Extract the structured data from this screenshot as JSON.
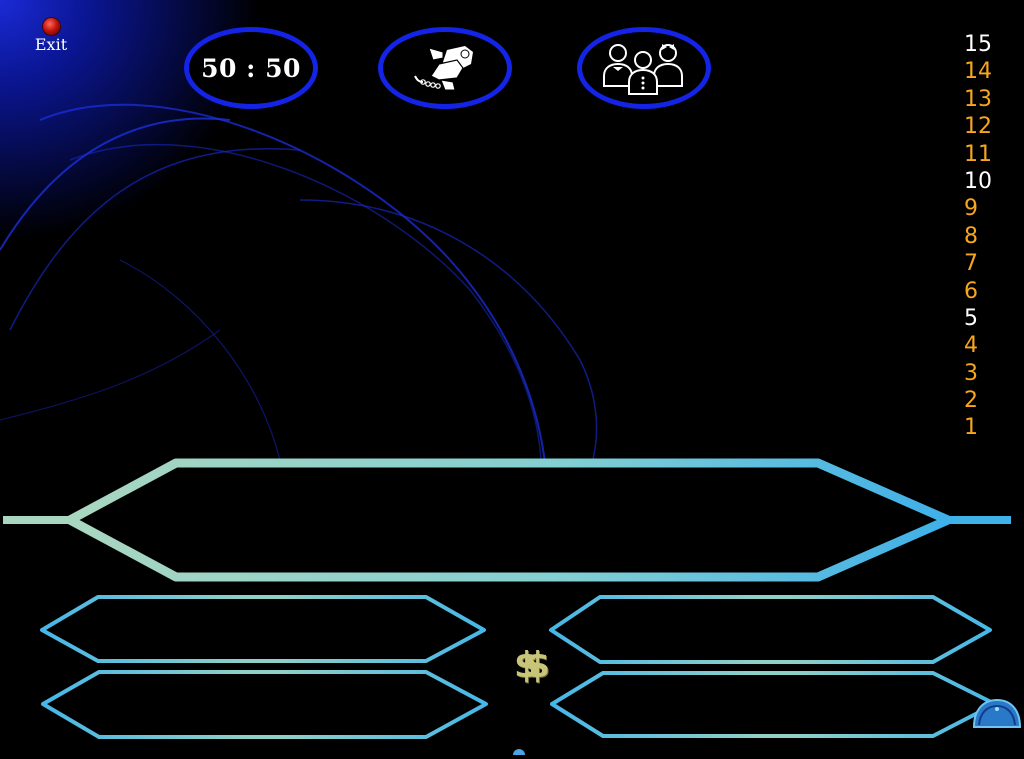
{
  "exit": {
    "label": "Exit"
  },
  "lifelines": {
    "fifty_fifty": {
      "label": "50 : 50",
      "icon": "fifty-fifty"
    },
    "phone_a_friend": {
      "icon": "phone-hand-icon"
    },
    "ask_audience": {
      "icon": "audience-people-icon"
    }
  },
  "ladder": {
    "rungs": [
      {
        "level": "15",
        "milestone": true
      },
      {
        "level": "14",
        "milestone": false
      },
      {
        "level": "13",
        "milestone": false
      },
      {
        "level": "12",
        "milestone": false
      },
      {
        "level": "11",
        "milestone": false
      },
      {
        "level": "10",
        "milestone": true
      },
      {
        "level": "9",
        "milestone": false
      },
      {
        "level": "8",
        "milestone": false
      },
      {
        "level": "7",
        "milestone": false
      },
      {
        "level": "6",
        "milestone": false
      },
      {
        "level": "5",
        "milestone": true
      },
      {
        "level": "4",
        "milestone": false
      },
      {
        "level": "3",
        "milestone": false
      },
      {
        "level": "2",
        "milestone": false
      },
      {
        "level": "1",
        "milestone": false
      }
    ],
    "colors": {
      "milestone": "#ffffff",
      "normal": "#f7a61e"
    }
  },
  "question": {
    "text": ""
  },
  "answers": {
    "a": "",
    "b": "",
    "c": "",
    "d": ""
  },
  "logo": {
    "text": "$$"
  },
  "colors": {
    "lifeline_border": "#1424e6",
    "frame_teal": "#8ed3c6",
    "frame_blue": "#3fb4e8"
  }
}
